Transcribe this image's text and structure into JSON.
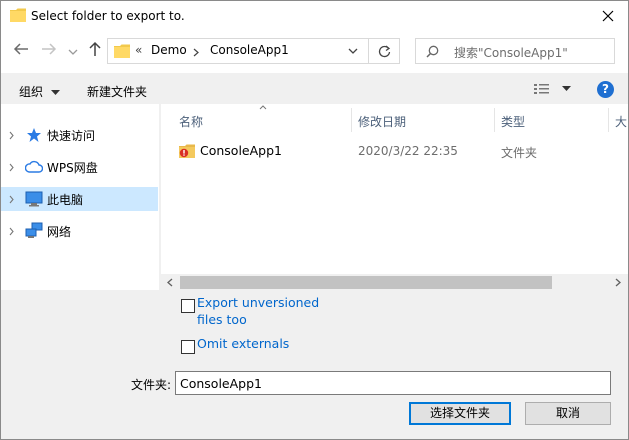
{
  "window": {
    "title": "Select folder to export to."
  },
  "nav": {
    "breadcrumb": [
      "Demo",
      "ConsoleApp1"
    ],
    "overflow_glyph": "«",
    "search_placeholder": "搜索\"ConsoleApp1\""
  },
  "toolbar": {
    "organize_label": "组织",
    "new_folder_label": "新建文件夹"
  },
  "sidebar": {
    "items": [
      {
        "label": "快速访问",
        "icon": "star-icon"
      },
      {
        "label": "WPS网盘",
        "icon": "cloud-icon"
      },
      {
        "label": "此电脑",
        "icon": "computer-icon",
        "selected": true
      },
      {
        "label": "网络",
        "icon": "network-icon"
      }
    ]
  },
  "columns": [
    "名称",
    "修改日期",
    "类型",
    "大"
  ],
  "rows": [
    {
      "name": "ConsoleApp1",
      "modified": "2020/3/22 22:35",
      "type": "文件夹"
    }
  ],
  "options": {
    "export_unversioned_line1": "Export unversioned",
    "export_unversioned_line2": "files too",
    "omit_externals": "Omit externals"
  },
  "footer": {
    "folder_label": "文件夹:",
    "folder_value": "ConsoleApp1",
    "select_button": "选择文件夹",
    "cancel_button": "取消"
  },
  "colors": {
    "accent": "#0078d7",
    "link": "#0066cc",
    "selected_bg": "#cce8ff",
    "help": "#1f6fd1"
  }
}
